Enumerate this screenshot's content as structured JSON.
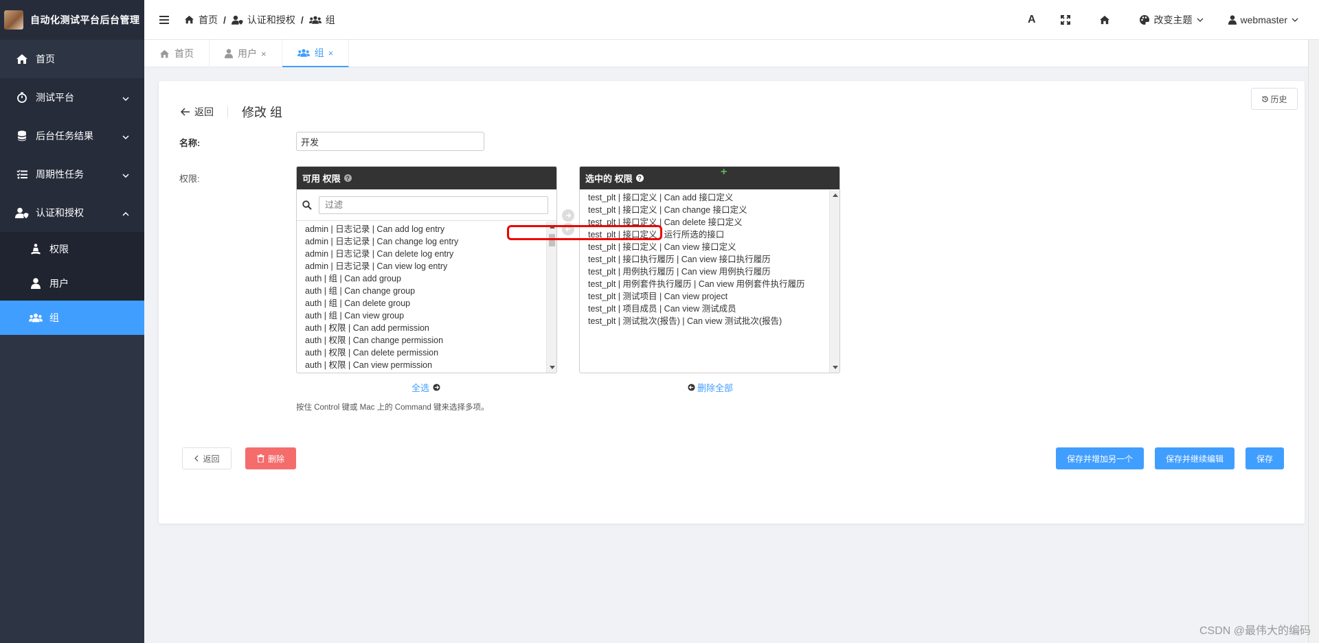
{
  "sidebar": {
    "brand": "自动化测试平台后台管理",
    "items": [
      {
        "label": "首页"
      },
      {
        "label": "测试平台"
      },
      {
        "label": "后台任务结果"
      },
      {
        "label": "周期性任务"
      },
      {
        "label": "认证和授权"
      }
    ],
    "sub_items": [
      {
        "label": "权限"
      },
      {
        "label": "用户"
      },
      {
        "label": "组"
      }
    ]
  },
  "topbar": {
    "breadcrumb": [
      "首页",
      "认证和授权",
      "组"
    ],
    "font_icon": "A",
    "theme_label": "改变主题",
    "user": "webmaster"
  },
  "tabs": [
    {
      "label": "首页"
    },
    {
      "label": "用户",
      "close": "×"
    },
    {
      "label": "组",
      "close": "×"
    }
  ],
  "form": {
    "history_label": "历史",
    "back_label": "返回",
    "title": "修改 组",
    "name_label": "名称:",
    "name_value": "开发",
    "perm_label": "权限:",
    "available_title": "可用 权限",
    "filter_placeholder": "过滤",
    "available": [
      "admin | 日志记录 | Can add log entry",
      "admin | 日志记录 | Can change log entry",
      "admin | 日志记录 | Can delete log entry",
      "admin | 日志记录 | Can view log entry",
      "auth | 组 | Can add group",
      "auth | 组 | Can change group",
      "auth | 组 | Can delete group",
      "auth | 组 | Can view group",
      "auth | 权限 | Can add permission",
      "auth | 权限 | Can change permission",
      "auth | 权限 | Can delete permission",
      "auth | 权限 | Can view permission"
    ],
    "chosen_title": "选中的 权限",
    "chosen": [
      "test_plt | 接口定义 | Can add 接口定义",
      "test_plt | 接口定义 | Can change 接口定义",
      "test_plt | 接口定义 | Can delete 接口定义",
      "test_plt | 接口定义 | 运行所选的接口",
      "test_plt | 接口定义 | Can view 接口定义",
      "test_plt | 接口执行履历 | Can view 接口执行履历",
      "test_plt | 用例执行履历 | Can view 用例执行履历",
      "test_plt | 用例套件执行履历 | Can view 用例套件执行履历",
      "test_plt | 测试项目 | Can view project",
      "test_plt | 项目成员 | Can view 测试成员",
      "test_plt | 测试批次(报告) | Can view 测试批次(报告)"
    ],
    "choose_all": "全选",
    "remove_all": "删除全部",
    "help": "按住 Control 键或 Mac 上的 Command 键来选择多项。",
    "buttons": {
      "back": "返回",
      "delete": "删除",
      "save_add": "保存并增加另一个",
      "save_continue": "保存并继续编辑",
      "save": "保存"
    }
  },
  "watermark": "CSDN @最伟大的编码",
  "colors": {
    "sidebar_bg": "#2d3444",
    "primary": "#409eff",
    "danger": "#f56c6c",
    "highlight": "#ee0000"
  }
}
